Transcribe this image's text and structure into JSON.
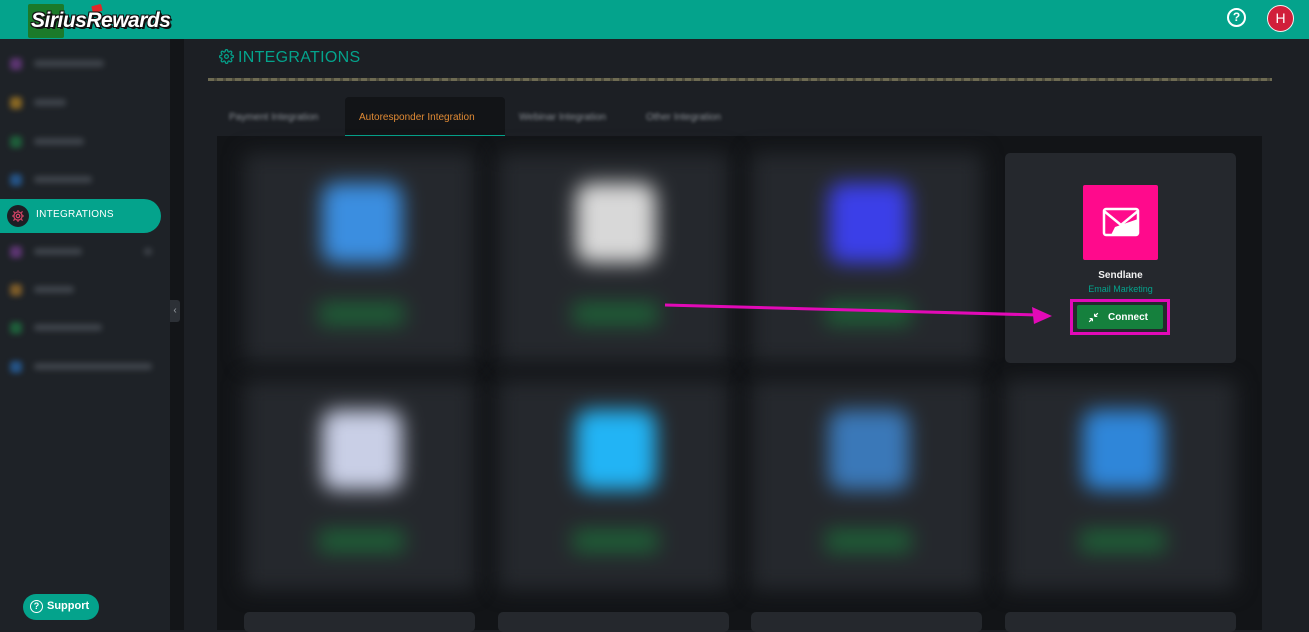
{
  "app": {
    "logo_text": "SiriusRewards",
    "help_icon": "question-circle-icon",
    "avatar_initial": "H"
  },
  "sidebar": {
    "active_item": {
      "label": "INTEGRATIONS",
      "icon": "gear-icon"
    },
    "support_label": "Support",
    "collapse_icon": "chevron-left-icon"
  },
  "page": {
    "title": "INTEGRATIONS",
    "title_icon": "gear-icon"
  },
  "tabs": [
    {
      "label": "Payment Integration",
      "active": false
    },
    {
      "label": "Autoresponder Integration",
      "active": true
    },
    {
      "label": "Webinar Integration",
      "active": false
    },
    {
      "label": "Other Integration",
      "active": false
    }
  ],
  "integration": {
    "name": "Sendlane",
    "category": "Email Marketing",
    "button_label": "Connect",
    "button_icon": "arrows-collapse-icon",
    "logo_icon": "sendlane-envelope-icon"
  },
  "colors": {
    "brand": "#04a38c",
    "active_tab": "#e08a34",
    "connect": "#15803d",
    "highlight": "#e20ab7",
    "sendlane": "#ff0a8c"
  }
}
